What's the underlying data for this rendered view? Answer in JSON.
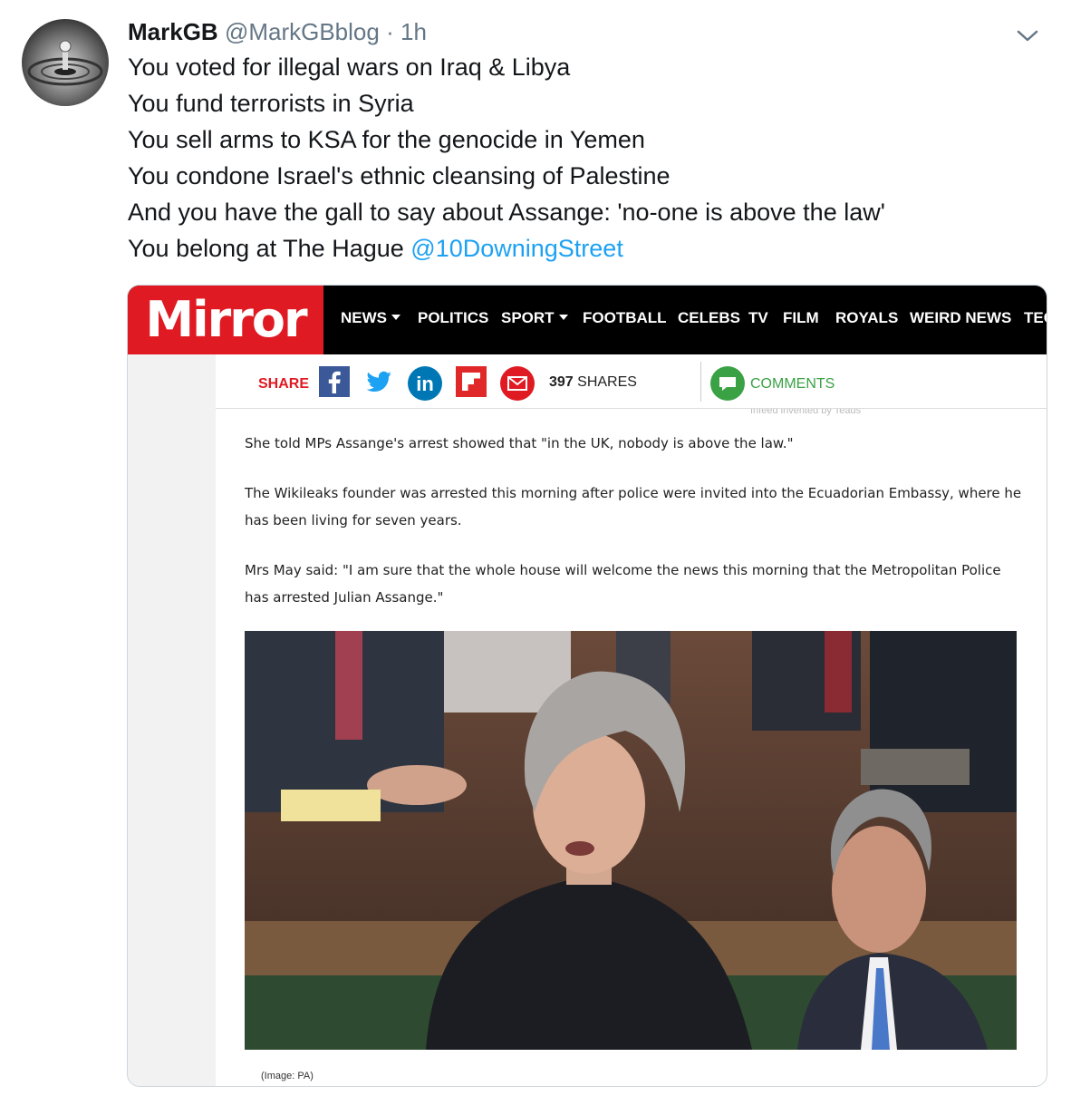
{
  "tweet": {
    "author_name": "MarkGB",
    "handle": "@MarkGBblog",
    "separator": "·",
    "time": "1h",
    "lines": [
      "You voted for illegal wars on Iraq & Libya",
      "You fund terrorists in Syria",
      "You sell arms to KSA for the genocide in Yemen",
      "You condone Israel's ethnic cleansing of Palestine",
      "And you have the gall to say about Assange: 'no-one is above the law'"
    ],
    "last_line_text": "You belong at The Hague",
    "mention": "@10DowningStreet"
  },
  "card": {
    "logo": "Mirror",
    "nav": [
      "NEWS",
      "POLITICS",
      "SPORT",
      "FOOTBALL",
      "CELEBS",
      "TV",
      "FILM",
      "ROYALS",
      "WEIRD NEWS",
      "TEC"
    ],
    "share_label": "SHARE",
    "share_count": "397",
    "share_count_suffix": "SHARES",
    "comments_label": "COMMENTS",
    "faint_text": "Infeed invented by Teads",
    "paragraphs": [
      "She told MPs Assange's arrest showed that \"in the UK, nobody is above the law.\"",
      "The Wikileaks founder was arrested this morning after police were invited into the Ecuadorian Embassy, where he has been living for seven years.",
      "Mrs May said: \"I am sure that the whole house will welcome the news this morning that the Metropolitan Police has arrested Julian Assange.\""
    ],
    "caption": "(Image: PA)"
  },
  "colors": {
    "link": "#1da1f2",
    "mirror_red": "#e01a22",
    "comments_green": "#3aa245"
  }
}
